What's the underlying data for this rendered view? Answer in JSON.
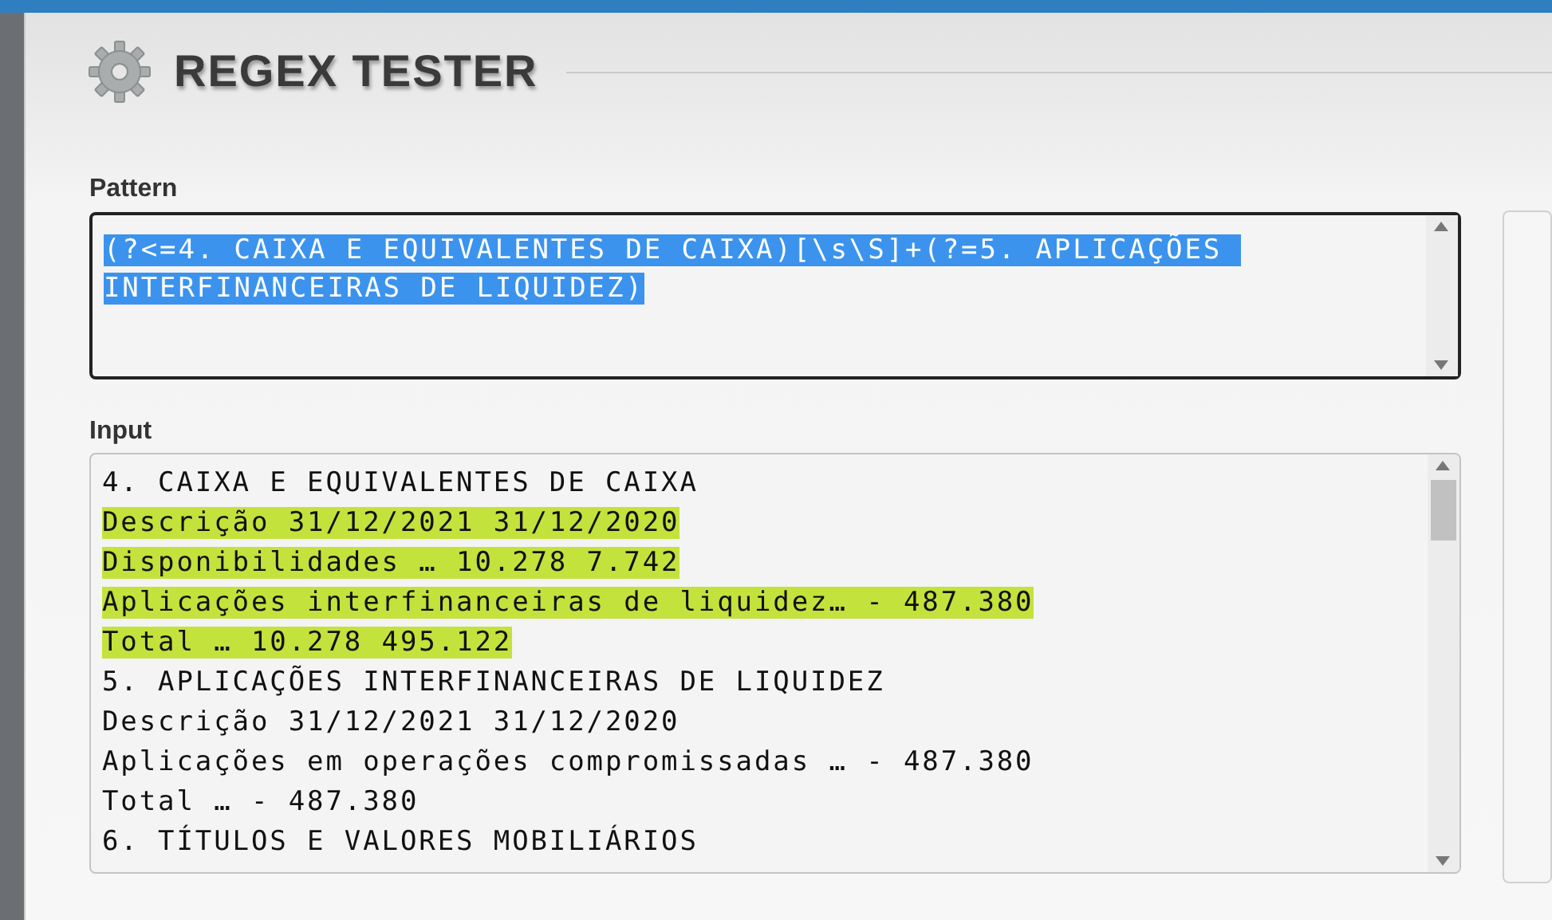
{
  "window": {
    "title": "REGEX TESTER"
  },
  "pattern": {
    "label": "Pattern",
    "lines": [
      {
        "text": "(?<=4. CAIXA E EQUIVALENTES DE CAIXA)[\\s\\S]+(?=5. APLICAÇÕES ",
        "selected": true
      },
      {
        "text": "INTERFINANCEIRAS DE LIQUIDEZ)",
        "selected": true
      }
    ]
  },
  "input": {
    "label": "Input",
    "lines": [
      {
        "text": "4. CAIXA E EQUIVALENTES DE CAIXA",
        "matched": false
      },
      {
        "text": "Descrição 31/12/2021 31/12/2020",
        "matched": true
      },
      {
        "text": "Disponibilidades … 10.278 7.742",
        "matched": true
      },
      {
        "text": "Aplicações interfinanceiras de liquidez… - 487.380",
        "matched": true
      },
      {
        "text": "Total … 10.278 495.122",
        "matched": true
      },
      {
        "text": "5. APLICAÇÕES INTERFINANCEIRAS DE LIQUIDEZ",
        "matched": false
      },
      {
        "text": "Descrição 31/12/2021 31/12/2020",
        "matched": false
      },
      {
        "text": "Aplicações em operações compromissadas … - 487.380",
        "matched": false
      },
      {
        "text": "Total … - 487.380",
        "matched": false
      },
      {
        "text": "6. TÍTULOS E VALORES MOBILIÁRIOS",
        "matched": false
      }
    ]
  }
}
